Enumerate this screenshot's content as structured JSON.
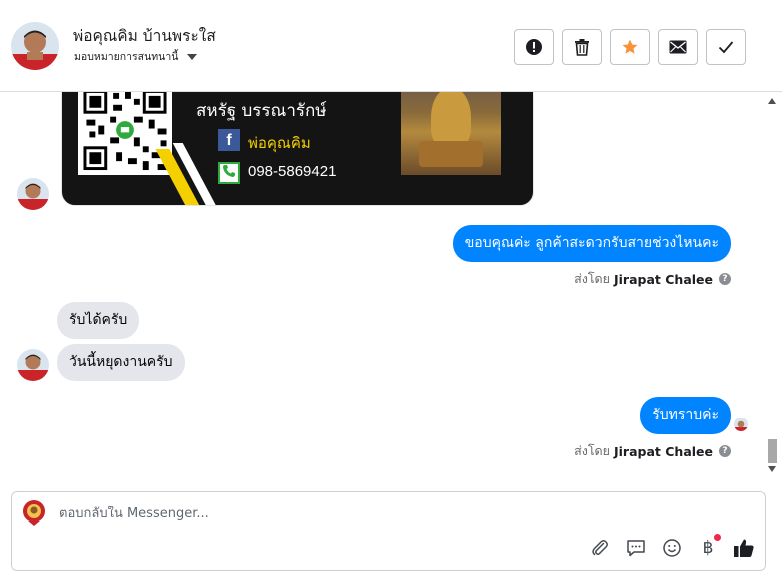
{
  "header": {
    "name": "พ่อคุณคิม บ้านพระใส",
    "assign_label": "มอบหมายการสนทนานี้",
    "actions": [
      {
        "icon": "alert-icon"
      },
      {
        "icon": "trash-icon"
      },
      {
        "icon": "star-icon"
      },
      {
        "icon": "mail-icon"
      },
      {
        "icon": "check-icon"
      }
    ],
    "star_color": "#f7923b"
  },
  "card": {
    "name": "สหรัฐ บรรณารักษ์",
    "facebook_letter": "f",
    "facebook": "พ่อคุณคิม",
    "phone": "098-5869421"
  },
  "messages": {
    "out1": {
      "text": "ขอบคุณค่ะ ลูกค้าสะดวกรับสายช่วงไหนคะ",
      "sent_by_label": "ส่งโดย",
      "sender": "Jirapat Chalee"
    },
    "in1": {
      "text": "รับได้ครับ"
    },
    "in2": {
      "text": "วันนี้หยุดงานครับ"
    },
    "out2": {
      "text": "รับทราบค่ะ",
      "sent_by_label": "ส่งโดย",
      "sender": "Jirapat Chalee"
    },
    "help_glyph": "?"
  },
  "composer": {
    "placeholder": "ตอบกลับใน Messenger...",
    "tools": [
      "paperclip-icon",
      "chat-icon",
      "emoji-icon",
      "baht-icon",
      "like-icon"
    ],
    "baht_glyph": "฿"
  },
  "colors": {
    "outgoing_bubble": "#0084ff",
    "incoming_bubble": "#e4e6eb",
    "like": "#1c1e21"
  }
}
